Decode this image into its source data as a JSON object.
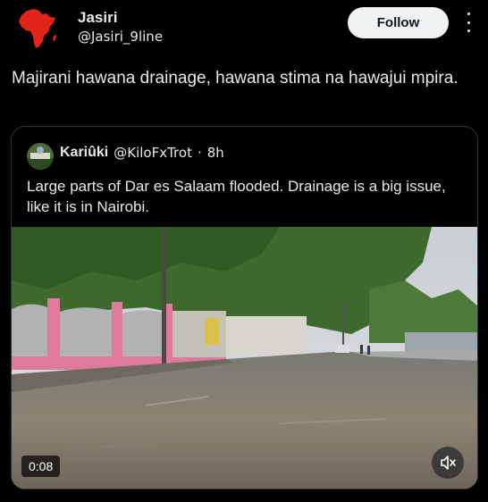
{
  "author": {
    "name": "Jasiri",
    "handle": "@Jasiri_9line",
    "avatar_icon": "africa-map-icon"
  },
  "actions": {
    "follow_label": "Follow",
    "more_icon": "more-vertical-icon"
  },
  "tweet": {
    "text": "Majirani hawana drainage, hawana stima na hawajui mpira."
  },
  "quoted": {
    "name": "Kariûki",
    "handle": "@KiloFxTrot",
    "separator": "·",
    "time": "8h",
    "text": "Large parts of Dar es Salaam flooded. Drainage is a big issue, like it is in Nairobi.",
    "avatar_icon": "profile-avatar-icon"
  },
  "video": {
    "duration": "0:08",
    "sound_icon": "volume-muted-icon"
  }
}
